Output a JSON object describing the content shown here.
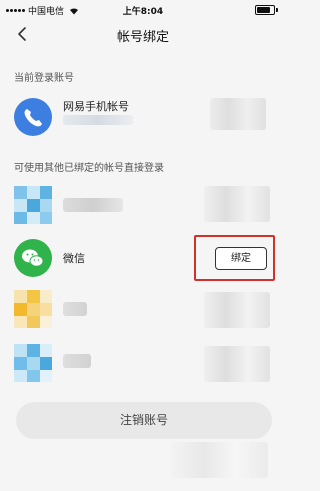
{
  "status_bar": {
    "carrier": "中国电信",
    "time": "上午8:04"
  },
  "nav": {
    "title": "帐号绑定"
  },
  "current_section": {
    "label": "当前登录账号",
    "account_label": "网易手机帐号"
  },
  "other_section": {
    "label": "可使用其他已绑定的帐号直接登录",
    "wechat_label": "微信",
    "bind_button_label": "绑定"
  },
  "cancel_button_label": "注销账号",
  "icons": {
    "back": "chevron-left-icon",
    "phone": "phone-icon",
    "wechat": "wechat-icon"
  },
  "colors": {
    "phone_avatar": "#3d7fe0",
    "wechat_avatar": "#2fb34a",
    "highlight": "#d0322b",
    "background": "#f5f5f5"
  }
}
